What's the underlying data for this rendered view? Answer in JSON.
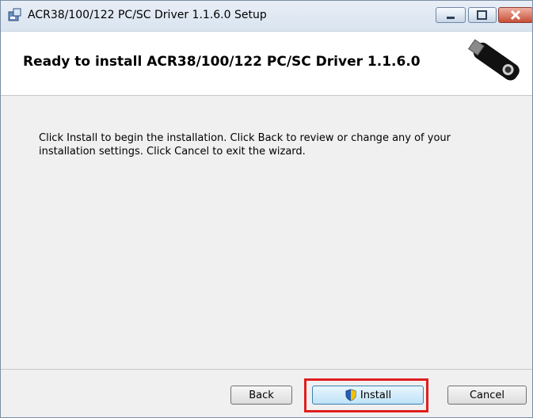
{
  "window": {
    "title": "ACR38/100/122 PC/SC Driver 1.1.6.0 Setup"
  },
  "header": {
    "title": "Ready to install ACR38/100/122 PC/SC Driver 1.1.6.0"
  },
  "body": {
    "description": "Click Install to begin the installation. Click Back to review or change any of your installation settings. Click Cancel to exit the wizard."
  },
  "buttons": {
    "back": "Back",
    "install": "Install",
    "cancel": "Cancel"
  },
  "icons": {
    "app": "installer-icon",
    "usb": "usb-token-image",
    "shield": "uac-shield-icon"
  }
}
